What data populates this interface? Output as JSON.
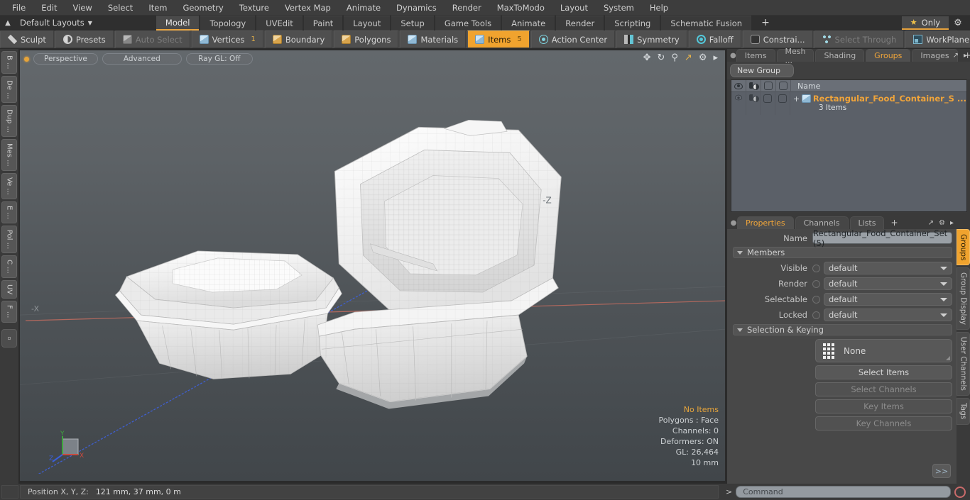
{
  "menubar": {
    "items": [
      "File",
      "Edit",
      "View",
      "Select",
      "Item",
      "Geometry",
      "Texture",
      "Vertex Map",
      "Animate",
      "Dynamics",
      "Render",
      "MaxToModo",
      "Layout",
      "System",
      "Help"
    ]
  },
  "layoutbar": {
    "title": "Default Layouts",
    "tabs": [
      {
        "label": "Model",
        "active": true
      },
      {
        "label": "Topology",
        "active": false
      },
      {
        "label": "UVEdit",
        "active": false
      },
      {
        "label": "Paint",
        "active": false
      },
      {
        "label": "Layout",
        "active": false
      },
      {
        "label": "Setup",
        "active": false
      },
      {
        "label": "Game Tools",
        "active": false
      },
      {
        "label": "Animate",
        "active": false
      },
      {
        "label": "Render",
        "active": false
      },
      {
        "label": "Scripting",
        "active": false
      },
      {
        "label": "Schematic Fusion",
        "active": false
      }
    ],
    "add_label": "+",
    "only_label": "Only"
  },
  "modebar": {
    "left": [
      {
        "label": "Sculpt",
        "icon": "pencil-icon",
        "state": "normal"
      },
      {
        "label": "Presets",
        "icon": "sphere-icon",
        "state": "normal"
      }
    ],
    "selection_modes": [
      {
        "label": "Auto Select",
        "icon": "cube-grey-icon",
        "state": "disabled",
        "count": ""
      },
      {
        "label": "Vertices",
        "icon": "cube-blue-icon",
        "state": "normal",
        "count": "1"
      },
      {
        "label": "Boundary",
        "icon": "cube-orange-icon",
        "state": "normal",
        "count": ""
      },
      {
        "label": "Polygons",
        "icon": "cube-orange-icon",
        "state": "normal",
        "count": ""
      },
      {
        "label": "Materials",
        "icon": "cube-blue-icon",
        "state": "normal",
        "count": ""
      },
      {
        "label": "Items",
        "icon": "cube-blue-icon",
        "state": "active",
        "count": "5"
      }
    ],
    "right": [
      {
        "label": "Action Center",
        "icon": "target-icon",
        "state": "normal"
      },
      {
        "label": "Symmetry",
        "icon": "bars-icon",
        "state": "normal"
      },
      {
        "label": "Falloff",
        "icon": "ring-icon",
        "state": "normal"
      },
      {
        "label": "Constrai...",
        "icon": "rounded-rect-icon",
        "state": "normal"
      },
      {
        "label": "Select Through",
        "icon": "nodes-icon",
        "state": "disabled"
      },
      {
        "label": "WorkPlane",
        "icon": "workplane-icon",
        "state": "normal"
      }
    ]
  },
  "leftrail": {
    "tabs": [
      "B ...",
      "De ...",
      "Dup ...",
      "Mes ...",
      "Ve ...",
      "E ...",
      "Pol ...",
      "C ...",
      "UV",
      "F ..."
    ]
  },
  "viewport": {
    "view_mode": "Perspective",
    "shading": "Advanced",
    "ray_gl": "Ray GL: Off",
    "icons": [
      "pan-icon",
      "rotate-icon",
      "zoom-icon",
      "fit-icon",
      "gear-icon",
      "arrow-right-icon"
    ],
    "axis_labels": {
      "x": "-X",
      "z": "-Z",
      "gizmo_x": "X",
      "gizmo_y": "Y",
      "gizmo_z": "Z"
    },
    "hud": {
      "selection": "No Items",
      "polygons": "Polygons : Face",
      "channels": "Channels: 0",
      "deformers": "Deformers: ON",
      "gl": "GL: 26,464",
      "scale": "10 mm"
    },
    "colors": {
      "bg_top": "#63686c",
      "bg_bottom": "#41464a",
      "axis_x": "#c06a60",
      "axis_z": "#4a6ad0",
      "mesh": "#f4f4f4",
      "accent": "#e8a33c"
    }
  },
  "grouppanel": {
    "tabs": [
      {
        "label": "Items",
        "active": false
      },
      {
        "label": "Mesh ...",
        "active": false
      },
      {
        "label": "Shading",
        "active": false
      },
      {
        "label": "Groups",
        "active": true
      },
      {
        "label": "Images",
        "active": false
      }
    ],
    "add_label": "+",
    "new_group_label": "New Group",
    "columns": [
      "visible-icon",
      "render-icon",
      "shaded-icon",
      "wireframe-icon"
    ],
    "name_column": "Name",
    "rows": [
      {
        "expand": "+",
        "name": "Rectangular_Food_Container_S ...",
        "sub": "3 Items"
      }
    ]
  },
  "properties": {
    "tabs": [
      {
        "label": "Properties",
        "active": true
      },
      {
        "label": "Channels",
        "active": false
      },
      {
        "label": "Lists",
        "active": false
      }
    ],
    "add_label": "+",
    "name_label": "Name",
    "name_value": "Rectangular_Food_Container_Set (5)",
    "members_section": "Members",
    "members": [
      {
        "label": "Visible",
        "value": "default"
      },
      {
        "label": "Render",
        "value": "default"
      },
      {
        "label": "Selectable",
        "value": "default"
      },
      {
        "label": "Locked",
        "value": "default"
      }
    ],
    "selection_section": "Selection & Keying",
    "selection_value": "None",
    "buttons": [
      {
        "label": "Select Items",
        "enabled": true
      },
      {
        "label": "Select Channels",
        "enabled": false
      },
      {
        "label": "Key Items",
        "enabled": false
      },
      {
        "label": "Key Channels",
        "enabled": false
      }
    ],
    "forward_label": ">>"
  },
  "rightrail": {
    "tabs": [
      {
        "label": "Groups",
        "active": true
      },
      {
        "label": "Group Display",
        "active": false
      },
      {
        "label": "User Channels",
        "active": false
      },
      {
        "label": "Tags",
        "active": false
      }
    ]
  },
  "statusbar": {
    "position_label": "Position X, Y, Z:",
    "position_value": "121 mm, 37 mm, 0 m",
    "command_prompt": ">",
    "command_placeholder": "Command"
  }
}
